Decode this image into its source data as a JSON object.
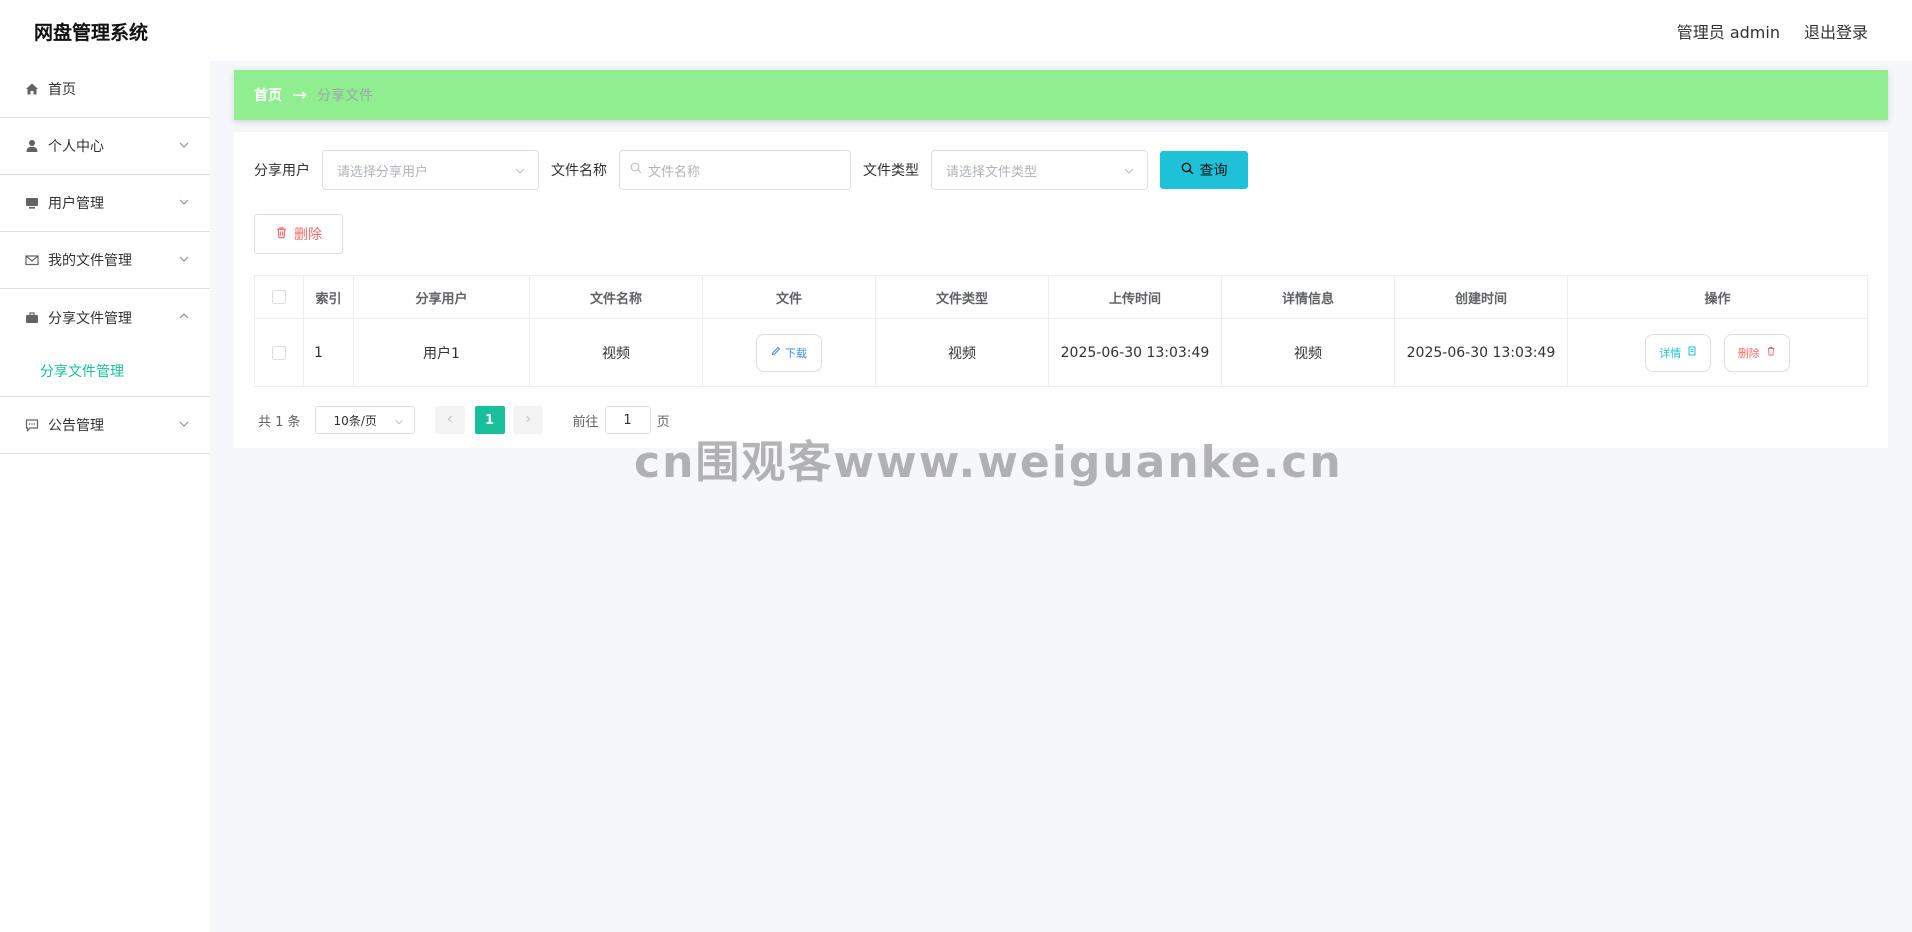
{
  "header": {
    "title": "网盘管理系统",
    "user_label": "管理员 admin",
    "logout_label": "退出登录"
  },
  "sidebar": {
    "items": [
      {
        "label": "首页",
        "icon": "home-icon"
      },
      {
        "label": "个人中心",
        "icon": "user-icon"
      },
      {
        "label": "用户管理",
        "icon": "monitor-icon"
      },
      {
        "label": "我的文件管理",
        "icon": "mail-icon"
      },
      {
        "label": "分享文件管理",
        "icon": "briefcase-icon",
        "expanded": true,
        "children": [
          "分享文件管理"
        ]
      },
      {
        "label": "公告管理",
        "icon": "chat-icon"
      }
    ]
  },
  "breadcrumb": {
    "home": "首页",
    "separator": "→",
    "current": "分享文件"
  },
  "search": {
    "user_label": "分享用户",
    "user_placeholder": "请选择分享用户",
    "name_label": "文件名称",
    "name_placeholder": "文件名称",
    "type_label": "文件类型",
    "type_placeholder": "请选择文件类型",
    "query_label": "查询"
  },
  "toolbar": {
    "delete_label": "删除"
  },
  "table": {
    "headers": [
      "索引",
      "分享用户",
      "文件名称",
      "文件",
      "文件类型",
      "上传时间",
      "详情信息",
      "创建时间",
      "操作"
    ],
    "rows": [
      {
        "index": "1",
        "user": "用户1",
        "file_name": "视频",
        "file_action": "下载",
        "file_type": "视频",
        "upload_time": "2025-06-30 13:03:49",
        "detail_info": "视频",
        "create_time": "2025-06-30 13:03:49",
        "detail_btn": "详情",
        "delete_btn": "删除"
      }
    ]
  },
  "pagination": {
    "total": "共 1 条",
    "page_size": "10条/页",
    "current_page": "1",
    "goto_prefix": "前往",
    "goto_value": "1",
    "goto_suffix": "页"
  },
  "watermark": "cn围观客www.weiguanke.cn",
  "colors": {
    "accent": "#19be9b",
    "breadcrumb_bg": "#90ee90",
    "query_bg": "#1fc1d8",
    "danger": "#f56c6c"
  }
}
